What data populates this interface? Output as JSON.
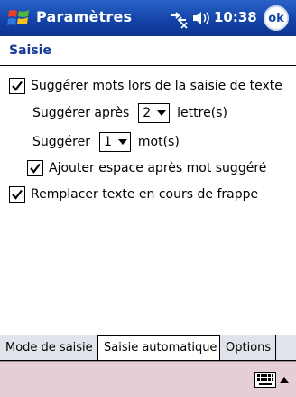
{
  "titlebar": {
    "title": "Paramètres",
    "time": "10:38",
    "ok_label": "ok"
  },
  "section": {
    "title": "Saisie"
  },
  "options": {
    "suggest_words": {
      "label": "Suggérer mots lors de la saisie de texte",
      "checked": true
    },
    "suggest_after": {
      "label": "Suggérer après",
      "value": "2",
      "suffix": "lettre(s)"
    },
    "suggest_count": {
      "label": "Suggérer",
      "value": "1",
      "suffix": "mot(s)"
    },
    "add_space": {
      "label": "Ajouter espace après mot suggéré",
      "checked": true
    },
    "replace_text": {
      "label": "Remplacer texte en cours de frappe",
      "checked": true
    }
  },
  "tabs": [
    {
      "label": "Mode de saisie",
      "active": false
    },
    {
      "label": "Saisie automatique",
      "active": true
    },
    {
      "label": "Options",
      "active": false
    }
  ],
  "icons": {
    "start": "windows-flag-icon",
    "connectivity": "connectivity-icon",
    "volume": "speaker-icon",
    "keyboard": "keyboard-icon",
    "sip": "arrow-up-icon"
  },
  "colors": {
    "titlebar": "#1444a8",
    "section_title": "#123a96",
    "command_bar": "#e6cfd4"
  }
}
